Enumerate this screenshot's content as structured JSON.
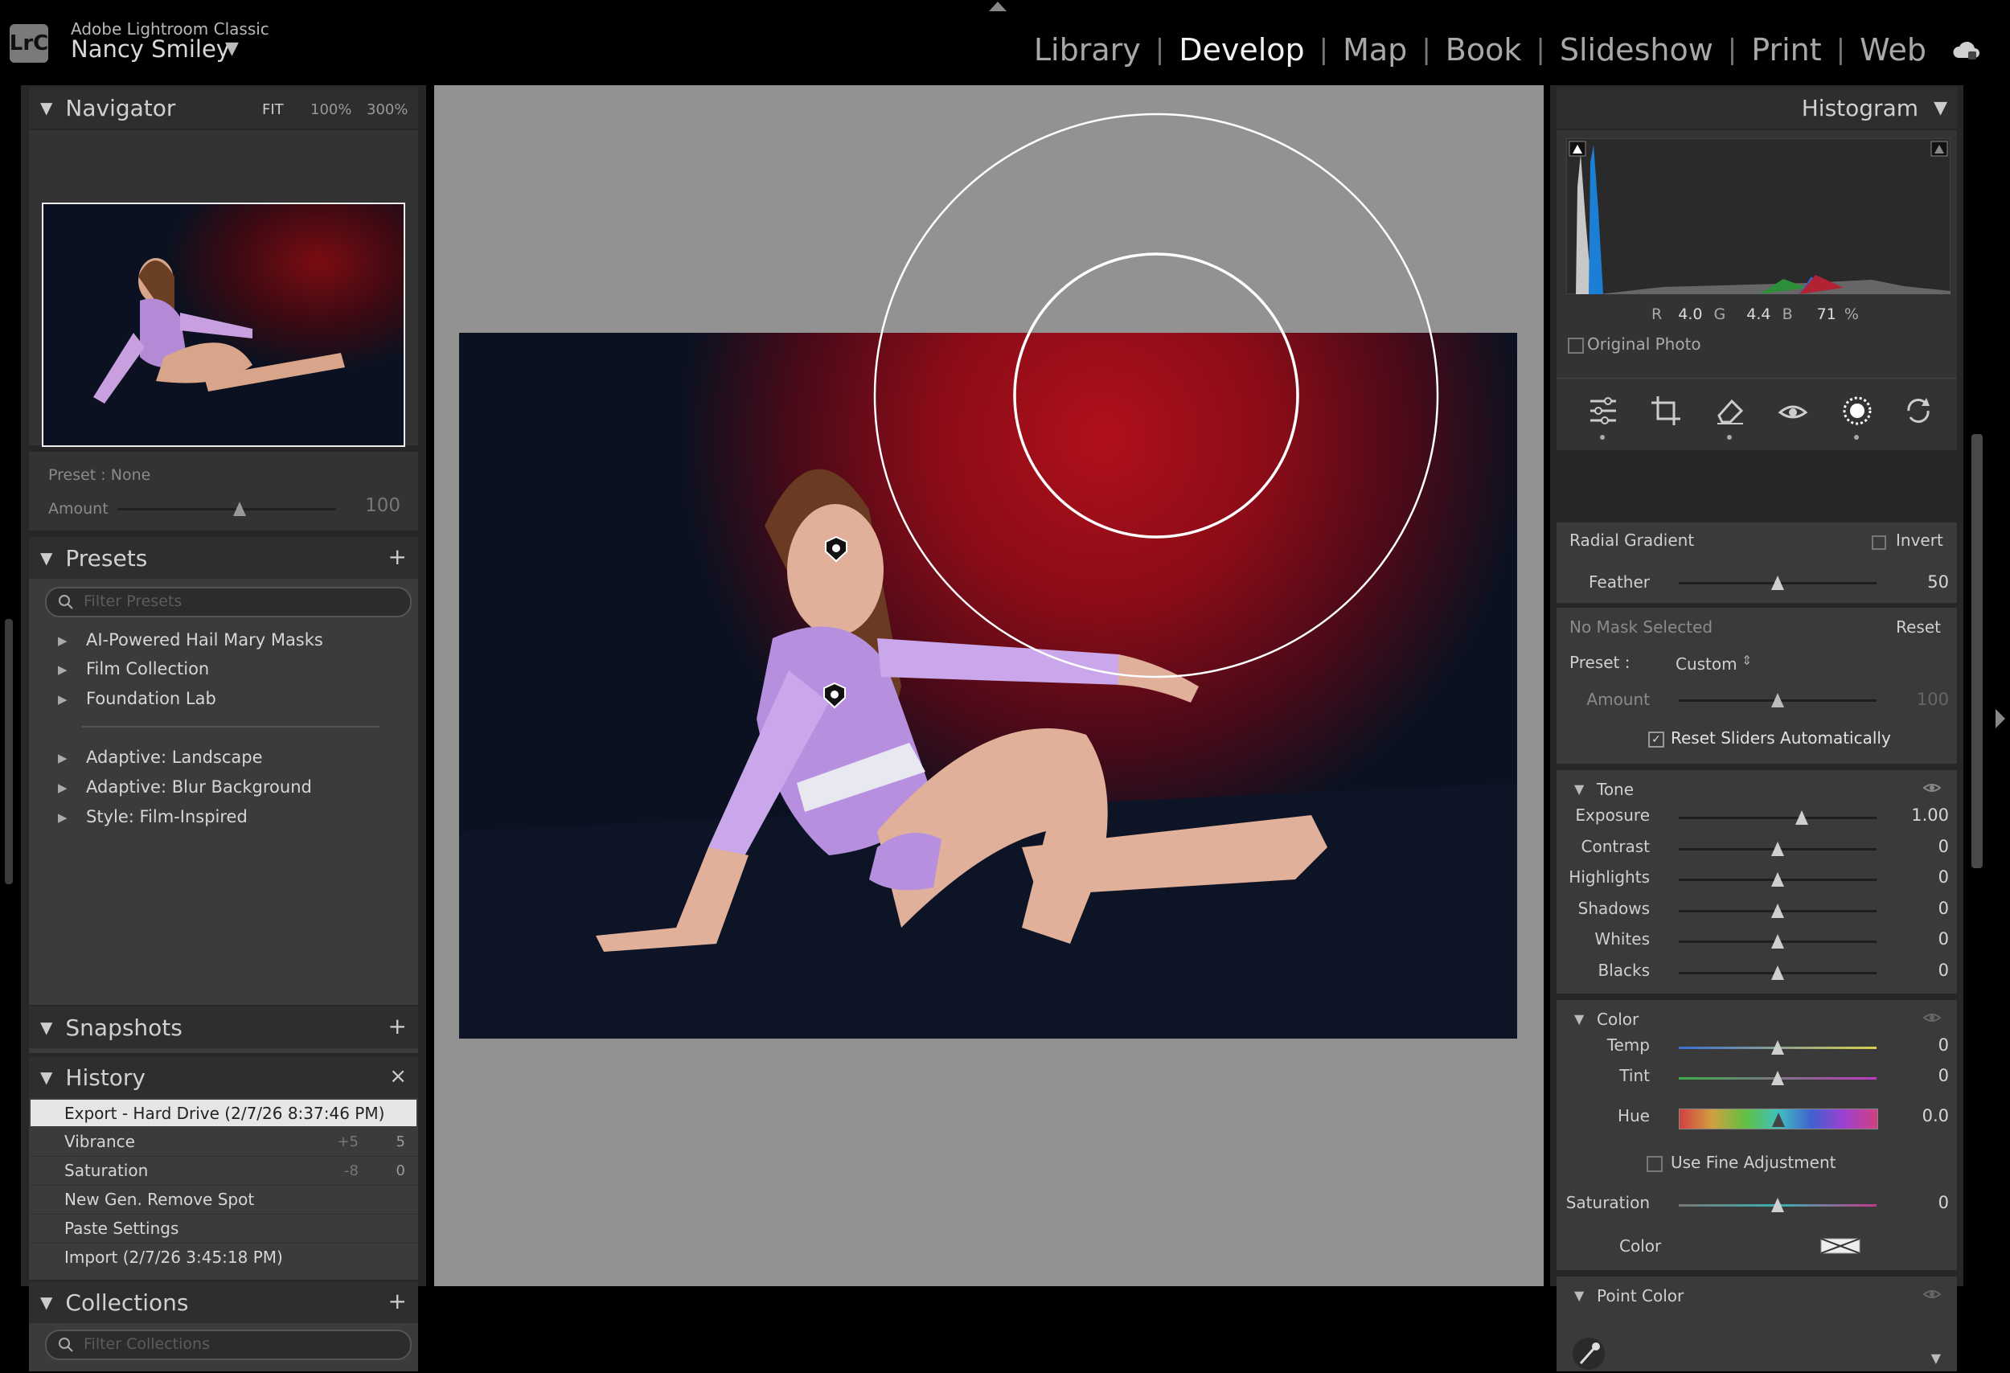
{
  "app": {
    "name": "Adobe Lightroom Classic",
    "logo": "LrC",
    "user": "Nancy Smiley",
    "modules": [
      "Library",
      "Develop",
      "Map",
      "Book",
      "Slideshow",
      "Print",
      "Web"
    ],
    "active_module": "Develop"
  },
  "left": {
    "navigator": {
      "title": "Navigator",
      "zoom": [
        "FIT",
        "100%",
        "300%"
      ]
    },
    "preset_amount": {
      "preset_label": "Preset : None",
      "amount_label": "Amount",
      "amount_value": "100",
      "amount_fraction": 0.56
    },
    "presets": {
      "title": "Presets",
      "filter_placeholder": "Filter Presets",
      "items": [
        "AI-Powered Hail Mary Masks",
        "Film Collection",
        "Foundation Lab",
        "Adaptive: Landscape",
        "Adaptive: Blur Background",
        "Style: Film-Inspired"
      ]
    },
    "snapshots": {
      "title": "Snapshots"
    },
    "history": {
      "title": "History",
      "items": [
        {
          "label": "Export - Hard Drive (2/7/26 8:37:46 PM)",
          "a": "",
          "b": ""
        },
        {
          "label": "Vibrance",
          "a": "+5",
          "b": "5"
        },
        {
          "label": "Saturation",
          "a": "-8",
          "b": "0"
        },
        {
          "label": "New Gen. Remove Spot",
          "a": "",
          "b": ""
        },
        {
          "label": "Paste Settings",
          "a": "",
          "b": ""
        },
        {
          "label": "Import (2/7/26 3:45:18 PM)",
          "a": "",
          "b": ""
        }
      ]
    },
    "collections": {
      "title": "Collections",
      "filter_placeholder": "Filter Collections"
    }
  },
  "right": {
    "histogram": {
      "title": "Histogram",
      "r_label": "R",
      "r": "4.0",
      "g_label": "G",
      "g": "4.4",
      "b_label": "B",
      "b": "71",
      "pct": "%",
      "original_photo": "Original Photo"
    },
    "mask": {
      "type": "Radial Gradient",
      "invert": "Invert",
      "feather_label": "Feather",
      "feather_value": "50",
      "feather_fraction": 0.5,
      "no_mask": "No Mask Selected",
      "reset": "Reset",
      "preset_label": "Preset :",
      "preset_value": "Custom",
      "amount_label": "Amount",
      "amount_value": "100",
      "reset_sliders": "Reset Sliders Automatically"
    },
    "tone": {
      "title": "Tone",
      "sliders": [
        {
          "label": "Exposure",
          "value": "1.00",
          "fraction": 0.62
        },
        {
          "label": "Contrast",
          "value": "0",
          "fraction": 0.5
        },
        {
          "label": "Highlights",
          "value": "0",
          "fraction": 0.5
        },
        {
          "label": "Shadows",
          "value": "0",
          "fraction": 0.5
        },
        {
          "label": "Whites",
          "value": "0",
          "fraction": 0.5
        },
        {
          "label": "Blacks",
          "value": "0",
          "fraction": 0.5
        }
      ]
    },
    "color": {
      "title": "Color",
      "temp_label": "Temp",
      "temp_value": "0",
      "tint_label": "Tint",
      "tint_value": "0",
      "hue_label": "Hue",
      "hue_value": "0.0",
      "fine_adjust": "Use Fine Adjustment",
      "saturation_label": "Saturation",
      "saturation_value": "0",
      "color_label": "Color"
    },
    "point_color": {
      "title": "Point Color"
    }
  },
  "colors": {
    "canvas_gray": "#929292",
    "panel": "#3b3b3b",
    "accent_red": "#b0101a"
  }
}
